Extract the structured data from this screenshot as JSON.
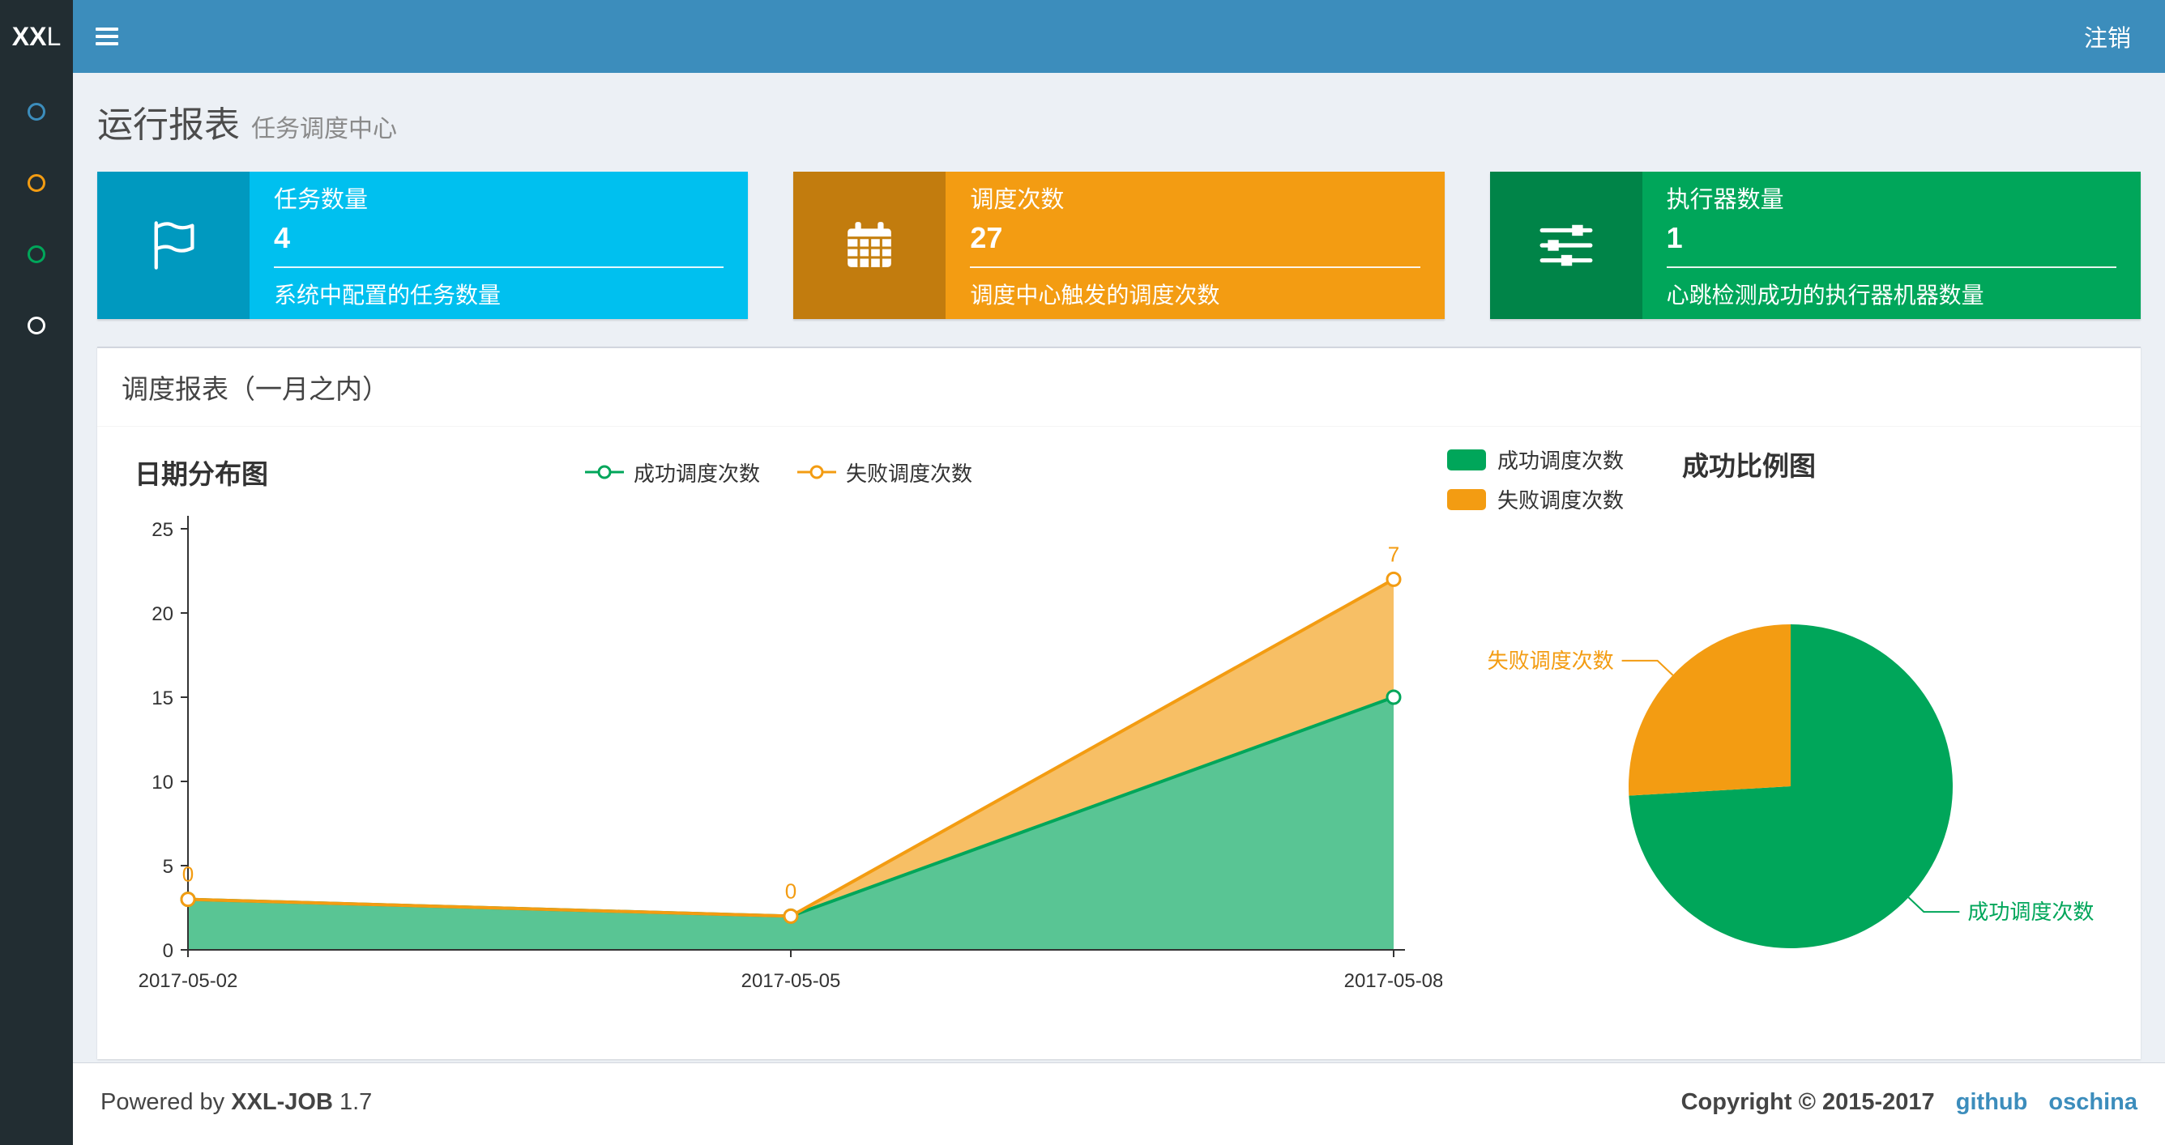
{
  "navbar": {
    "logo_bold": "XX",
    "logo_light": "L",
    "logout_label": "注销"
  },
  "sidebar": {
    "items": [
      {
        "key": "dashboard",
        "icon": "circle-icon",
        "color": "#3c8dbc"
      },
      {
        "key": "job-manage",
        "icon": "circle-icon",
        "color": "#f39c12"
      },
      {
        "key": "job-log",
        "icon": "circle-icon",
        "color": "#00a65a"
      },
      {
        "key": "executor-manage",
        "icon": "circle-icon",
        "color": "#ffffff"
      }
    ]
  },
  "page_header": {
    "title": "运行报表",
    "subtitle": "任务调度中心"
  },
  "info_boxes": [
    {
      "title": "任务数量",
      "value": "4",
      "description": "系统中配置的任务数量",
      "bg_color": "#00c0ef",
      "icon": "flag-icon"
    },
    {
      "title": "调度次数",
      "value": "27",
      "description": "调度中心触发的调度次数",
      "bg_color": "#f39c12",
      "icon": "calendar-icon"
    },
    {
      "title": "执行器数量",
      "value": "1",
      "description": "心跳检测成功的执行器机器数量",
      "bg_color": "#00a65a",
      "icon": "sliders-icon"
    }
  ],
  "panel": {
    "title": "调度报表（一月之内）"
  },
  "chart_data": [
    {
      "id": "date-distribution",
      "type": "area",
      "title": "日期分布图",
      "x": [
        "2017-05-02",
        "2017-05-05",
        "2017-05-08"
      ],
      "stacked": true,
      "series": [
        {
          "key": "success",
          "name": "成功调度次数",
          "color": "#00a65a",
          "values": [
            3,
            2,
            15
          ],
          "show_point_labels": false
        },
        {
          "key": "fail",
          "name": "失败调度次数",
          "color": "#f39c12",
          "values": [
            0,
            0,
            7
          ],
          "show_point_labels": true,
          "point_labels": [
            "0",
            "0",
            "7"
          ]
        }
      ],
      "ylim": [
        0,
        25
      ],
      "yticks": [
        0,
        5,
        10,
        15,
        20,
        25
      ],
      "fill_opacity": 0.65,
      "legend_position": "top-center",
      "grid": false
    },
    {
      "id": "success-ratio",
      "type": "pie",
      "title": "成功比例图",
      "slices": [
        {
          "key": "success",
          "name": "成功调度次数",
          "value": 20,
          "color": "#00a65a"
        },
        {
          "key": "fail",
          "name": "失败调度次数",
          "value": 7,
          "color": "#f39c12"
        }
      ],
      "legend_position": "top-left",
      "start_angle_deg": 0,
      "direction": "clockwise"
    }
  ],
  "footer": {
    "powered_prefix": "Powered by",
    "product": "XXL-JOB",
    "version": "1.7",
    "copyright": "Copyright © 2015-2017",
    "links": [
      {
        "label": "github"
      },
      {
        "label": "oschina"
      }
    ]
  },
  "colors": {
    "navbar_bg": "#3c8dbc",
    "sidebar_bg": "#222d32",
    "content_bg": "#ecf0f5",
    "link": "#3c8dbc"
  }
}
